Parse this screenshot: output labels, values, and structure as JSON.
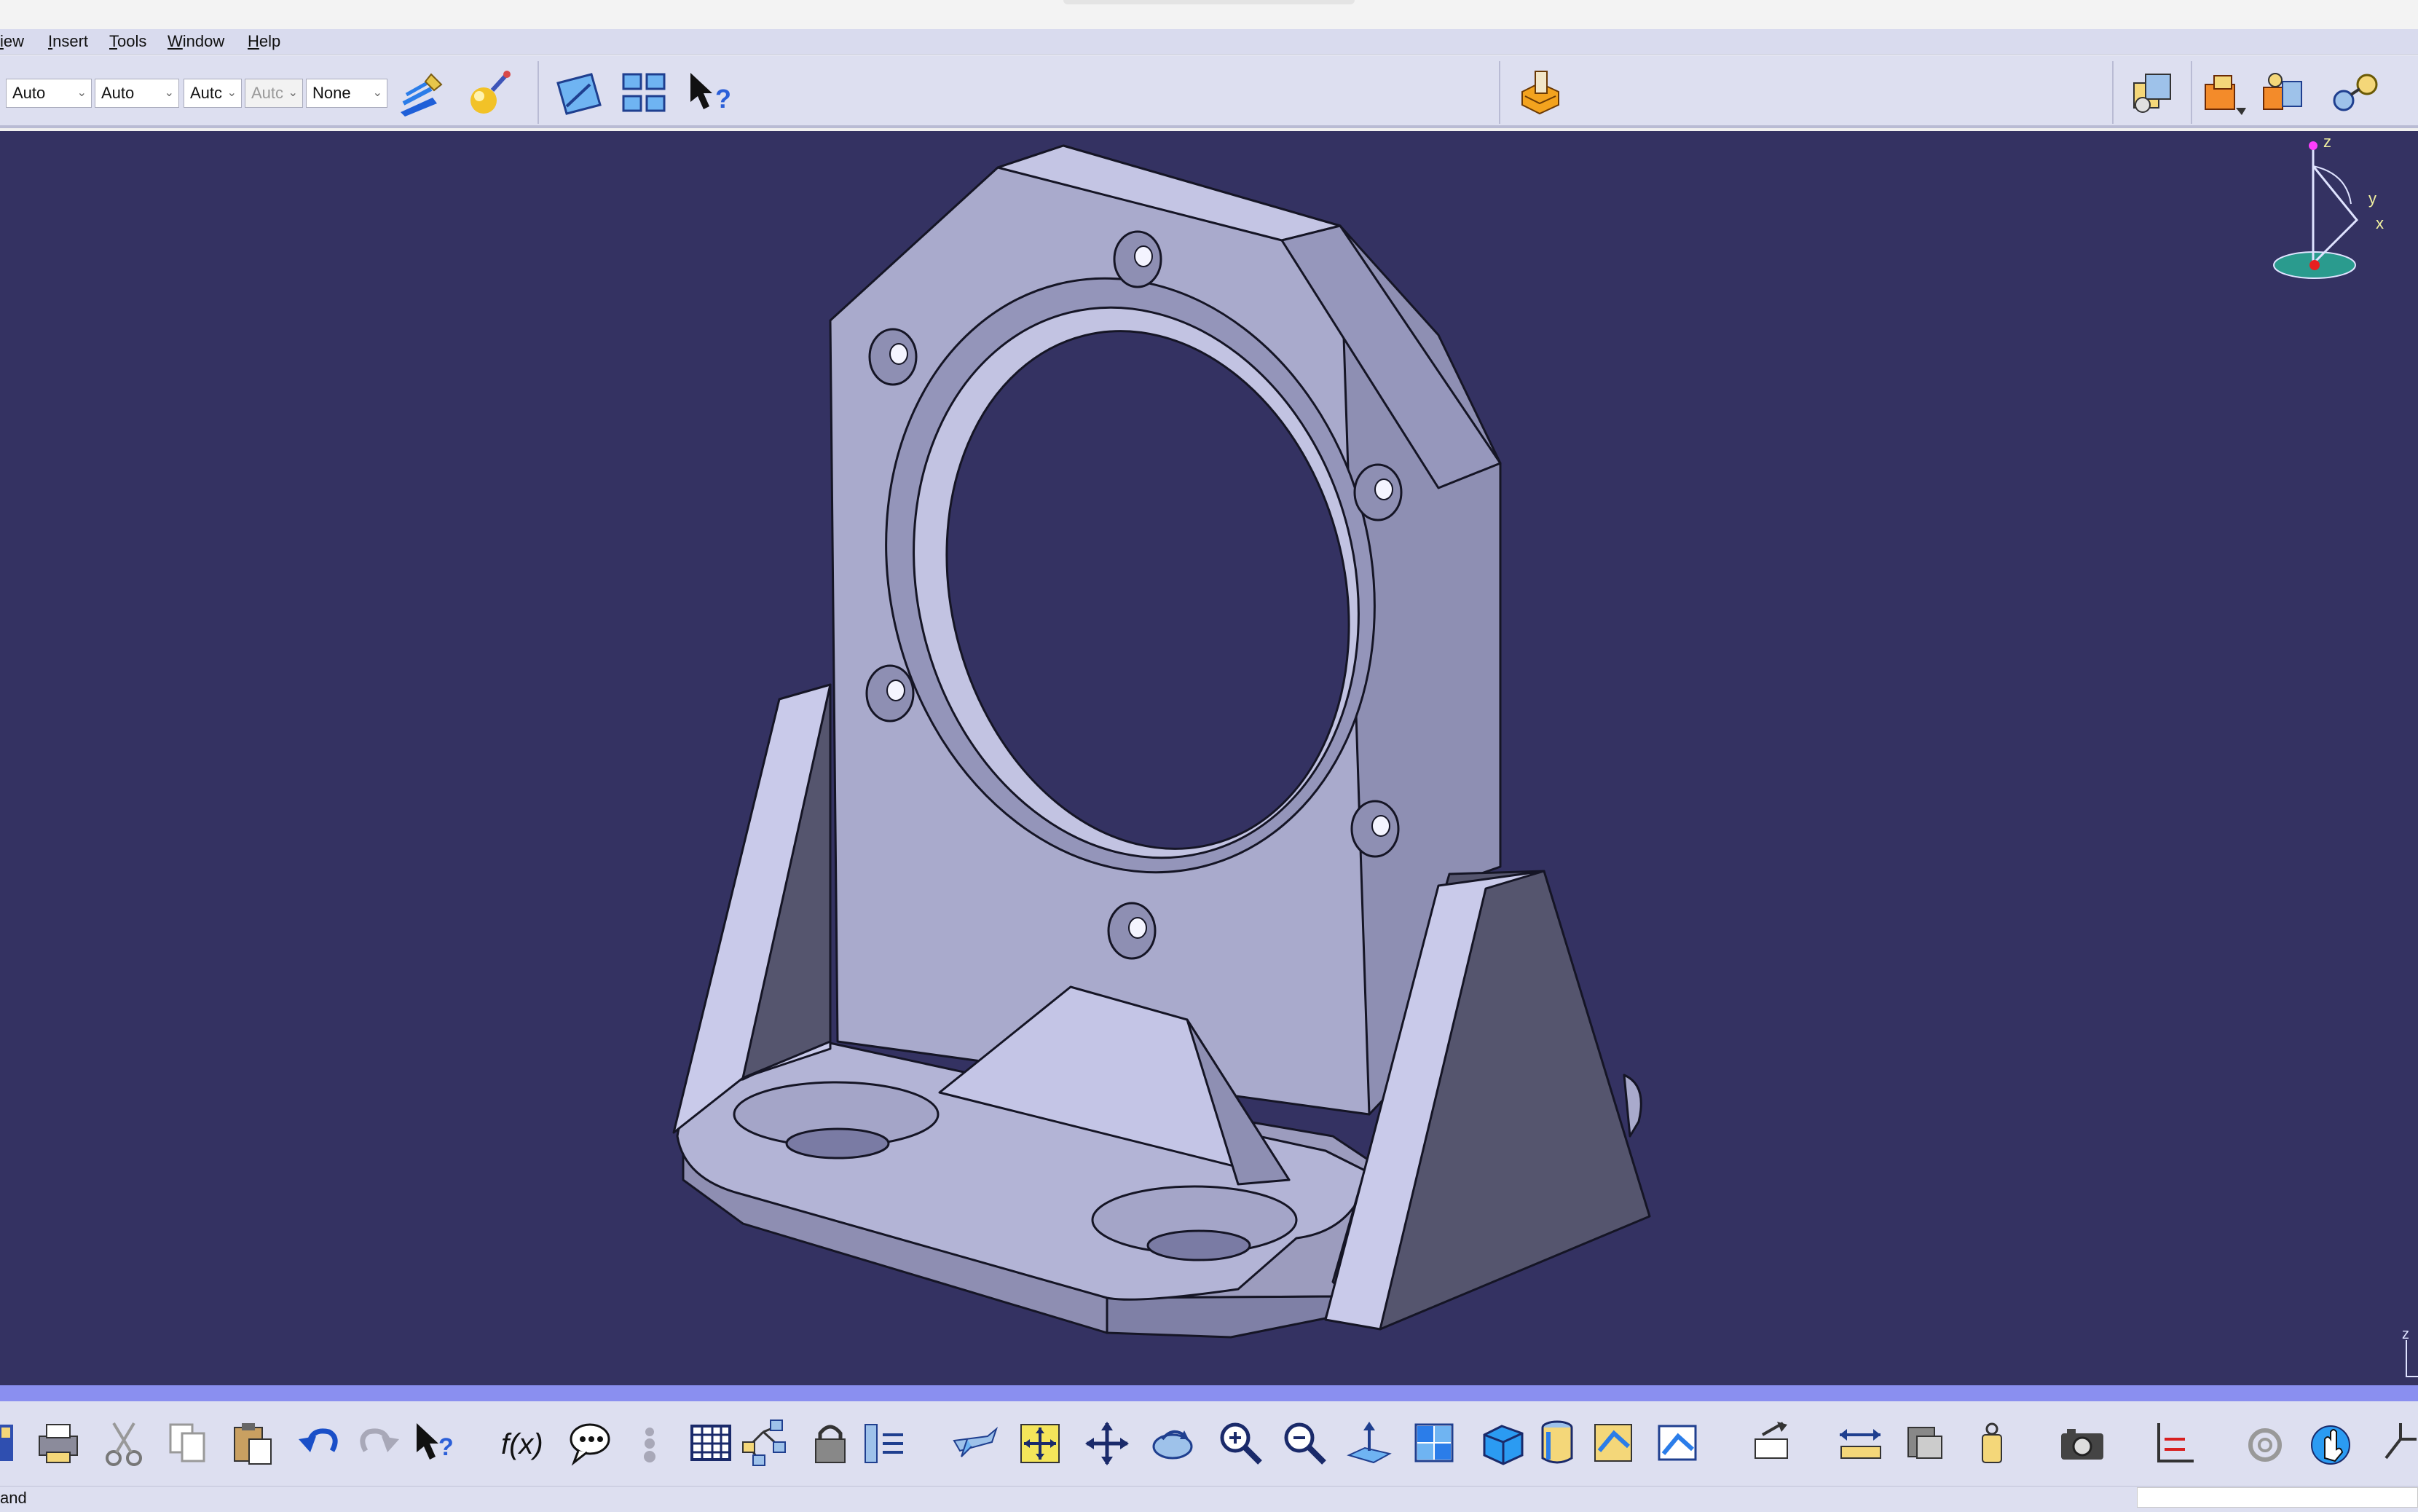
{
  "menu": {
    "items": [
      {
        "id": "view",
        "label": "iew"
      },
      {
        "id": "insert",
        "label": "Insert"
      },
      {
        "id": "tools",
        "label": "Tools"
      },
      {
        "id": "window",
        "label": "Window"
      },
      {
        "id": "help",
        "label": "Help"
      }
    ]
  },
  "graphic_properties": {
    "combos": [
      {
        "label": "Auto"
      },
      {
        "label": "Auto"
      },
      {
        "label": "Autc"
      },
      {
        "label": "Autc"
      },
      {
        "label": "None"
      }
    ]
  },
  "compass": {
    "z_label": "z",
    "y_label": "y",
    "x_label": "x"
  },
  "corner_axis": {
    "z_label": "z"
  },
  "status": {
    "text": "and"
  },
  "colors": {
    "viewport_background": "#343262",
    "part_face": "#a9aacc",
    "toolbar_background": "#dddff0",
    "accent_strip": "#8a8ff0"
  }
}
